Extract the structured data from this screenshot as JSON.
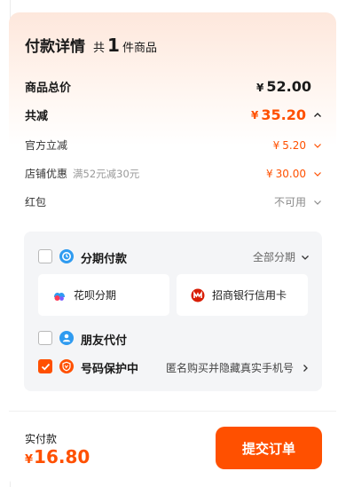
{
  "header": {
    "title": "付款详情",
    "count_prefix": "共",
    "count": "1",
    "count_suffix": "件商品"
  },
  "summary": {
    "total_label": "商品总价",
    "total_currency": "¥",
    "total_value": "52.00",
    "discount_label": "共减",
    "discount_currency": "¥",
    "discount_value": "35.20",
    "official_label": "官方立减",
    "official_currency": "¥",
    "official_value": "5.20",
    "store_label": "店铺优惠",
    "store_hint": "满52元减30元",
    "store_currency": "¥",
    "store_value": "30.00",
    "redpacket_label": "红包",
    "redpacket_value": "不可用"
  },
  "payment": {
    "installment_label": "分期付款",
    "installment_all": "全部分期",
    "cards": [
      {
        "label": "花呗分期",
        "icon": "huabei-icon"
      },
      {
        "label": "招商银行信用卡",
        "icon": "cmb-bank-icon"
      }
    ],
    "friend_label": "朋友代付",
    "privacy_label": "号码保护中",
    "privacy_note": "匿名购买并隐藏真实手机号"
  },
  "footer": {
    "label": "实付款",
    "currency": "¥",
    "amount": "16.80",
    "submit_label": "提交订单"
  },
  "colors": {
    "accent": "#ff5000",
    "blue_icon": "#2f9bf0"
  }
}
